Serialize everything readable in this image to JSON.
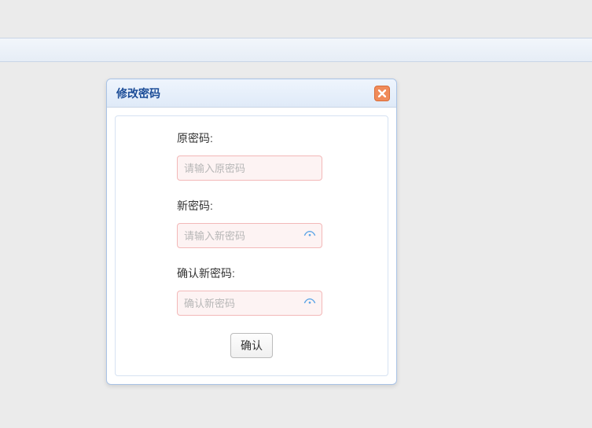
{
  "dialog": {
    "title": "修改密码",
    "fields": {
      "old_password": {
        "label": "原密码:",
        "placeholder": "请输入原密码",
        "value": ""
      },
      "new_password": {
        "label": "新密码:",
        "placeholder": "请输入新密码",
        "value": ""
      },
      "confirm_password": {
        "label": "确认新密码:",
        "placeholder": "确认新密码",
        "value": ""
      }
    },
    "buttons": {
      "submit": "确认"
    }
  },
  "colors": {
    "header_text": "#1b4c97",
    "input_border_error": "#f3b8b8",
    "input_bg_error": "#fdf3f3",
    "eye_icon": "#5ba4e6",
    "close_bg": "#f08b5a"
  }
}
